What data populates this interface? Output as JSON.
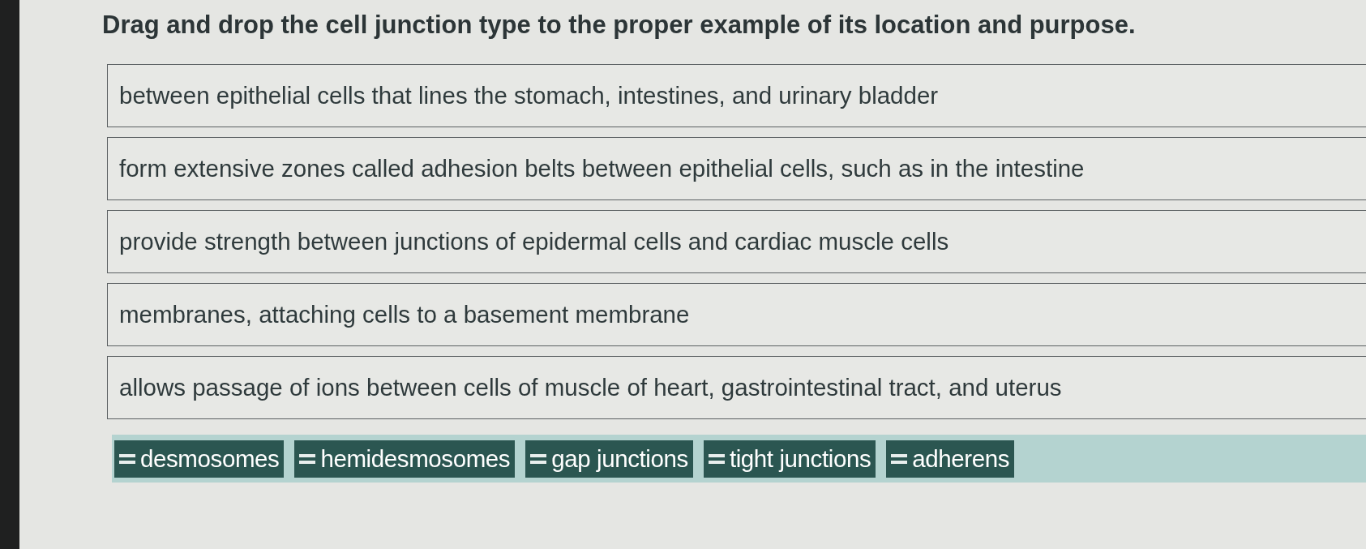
{
  "question": {
    "title": "Drag and drop the cell junction type to the proper example of its location and purpose."
  },
  "drop_zones": [
    {
      "text": "between epithelial cells that lines the stomach, intestines, and urinary bladder"
    },
    {
      "text": "form extensive zones called adhesion belts between epithelial cells, such as in the intestine"
    },
    {
      "text": "provide strength between junctions of epidermal cells and cardiac muscle cells"
    },
    {
      "text": "membranes, attaching cells to a basement membrane"
    },
    {
      "text": "allows passage of ions between cells of muscle of heart, gastrointestinal tract, and uterus"
    }
  ],
  "options": [
    {
      "label": "desmosomes"
    },
    {
      "label": "hemidesmosomes"
    },
    {
      "label": "gap junctions"
    },
    {
      "label": "tight junctions"
    },
    {
      "label": "adherens"
    }
  ]
}
